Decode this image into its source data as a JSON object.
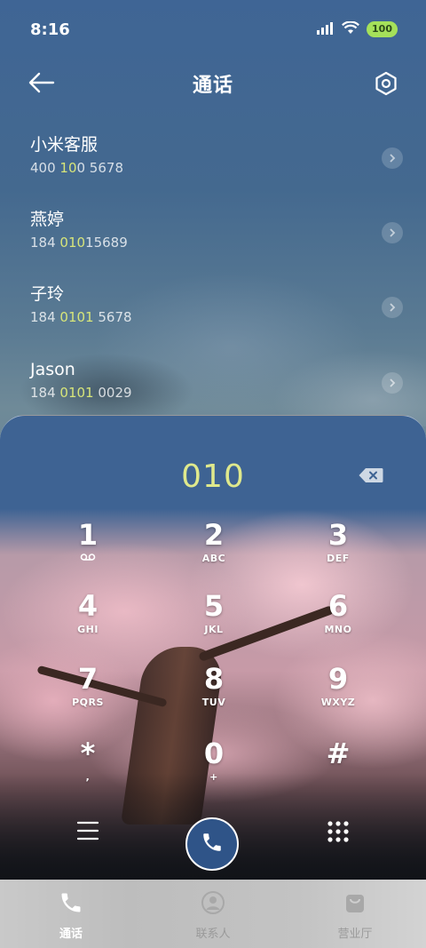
{
  "status": {
    "time": "8:16",
    "battery": "100"
  },
  "header": {
    "title": "通话"
  },
  "contacts": [
    {
      "name": "小米客服",
      "num_pre": "400 ",
      "num_hl": "10",
      "num_post": "0 5678"
    },
    {
      "name": "燕婷",
      "num_pre": "184 ",
      "num_hl": "010",
      "num_post": "15689"
    },
    {
      "name": "子玲",
      "num_pre": "184 ",
      "num_hl": "0101",
      "num_post": " 5678"
    },
    {
      "name": "Jason",
      "num_pre": "184 ",
      "num_hl": "0101",
      "num_post": " 0029"
    }
  ],
  "dialer": {
    "entered": "010",
    "keys": [
      {
        "digit": "1",
        "letters": ""
      },
      {
        "digit": "2",
        "letters": "ABC"
      },
      {
        "digit": "3",
        "letters": "DEF"
      },
      {
        "digit": "4",
        "letters": "GHI"
      },
      {
        "digit": "5",
        "letters": "JKL"
      },
      {
        "digit": "6",
        "letters": "MNO"
      },
      {
        "digit": "7",
        "letters": "PQRS"
      },
      {
        "digit": "8",
        "letters": "TUV"
      },
      {
        "digit": "9",
        "letters": "WXYZ"
      },
      {
        "digit": "*",
        "letters": ","
      },
      {
        "digit": "0",
        "letters": "+"
      },
      {
        "digit": "#",
        "letters": ""
      }
    ]
  },
  "tabs": [
    {
      "label": "通话",
      "icon": "phone-icon",
      "active": true
    },
    {
      "label": "联系人",
      "icon": "person-icon",
      "active": false
    },
    {
      "label": "营业厅",
      "icon": "shop-bag-icon",
      "active": false
    }
  ],
  "colors": {
    "accent_highlight": "#d7e57a",
    "call_button": "#2f5488",
    "battery": "#a5e15a"
  }
}
